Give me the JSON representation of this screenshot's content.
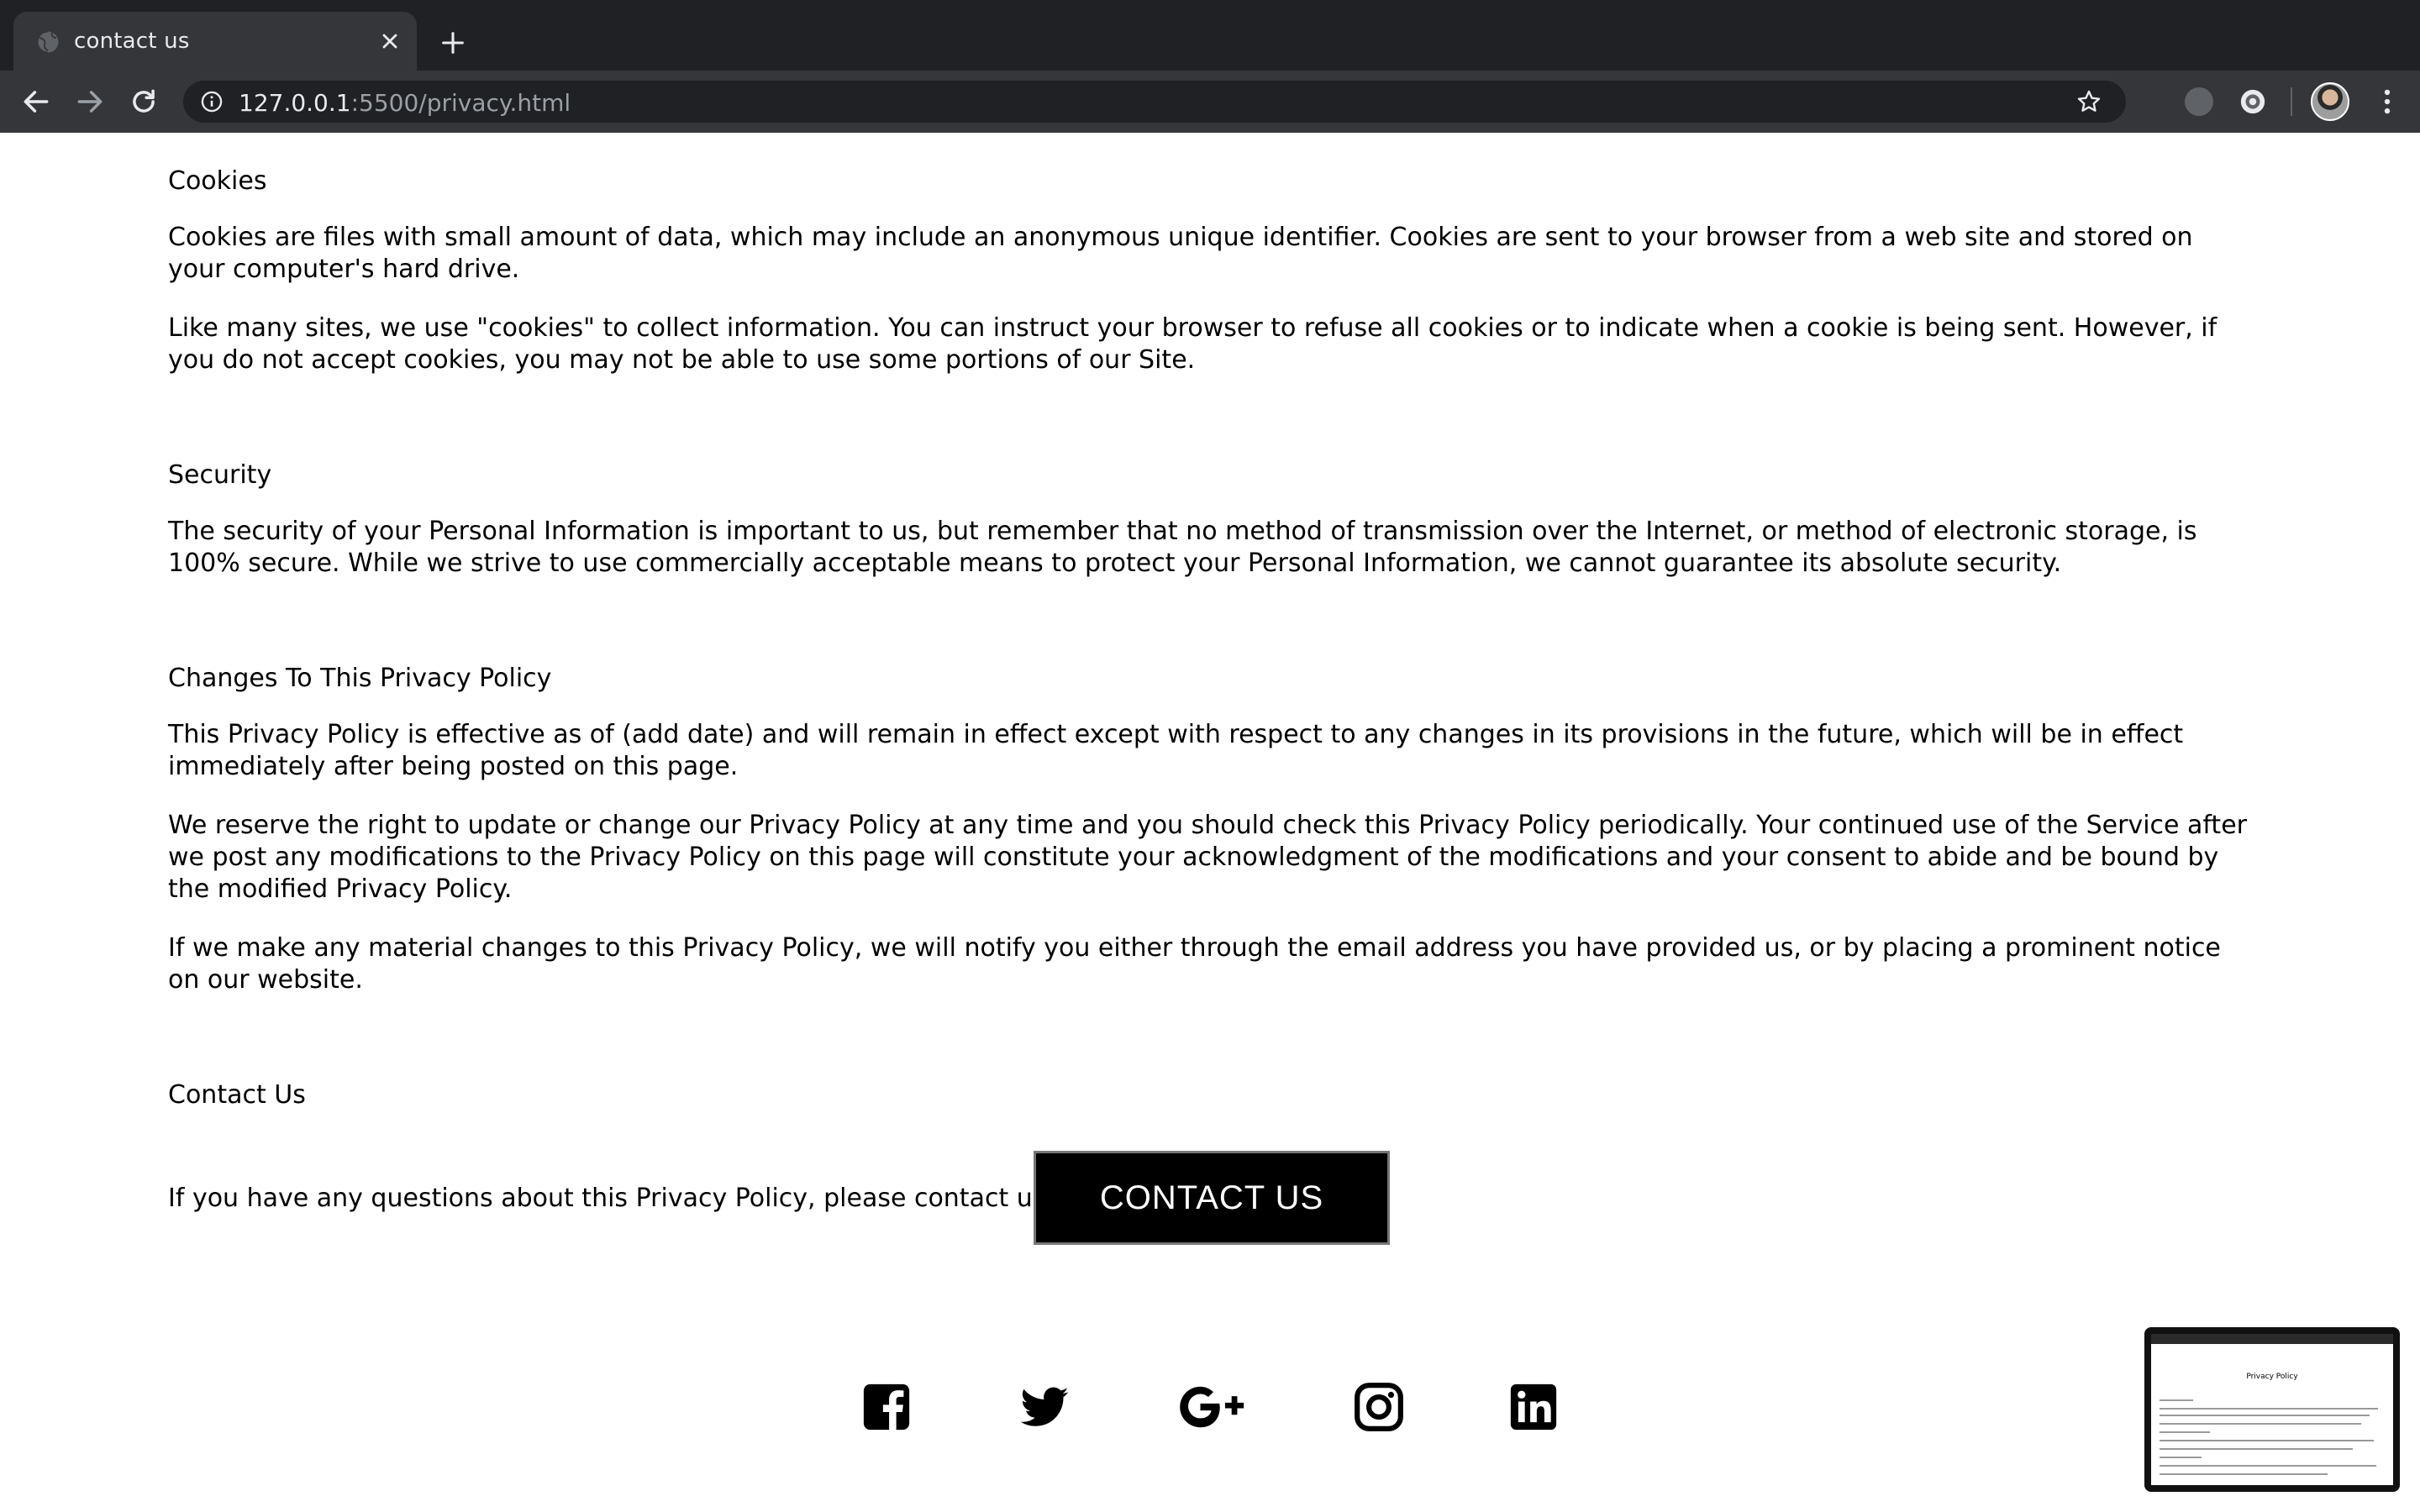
{
  "browser": {
    "tab_title": "contact us",
    "url_host": "127.0.0.1",
    "url_rest": ":5500/privacy.html"
  },
  "sections": {
    "cookies": {
      "heading": "Cookies",
      "p1": "Cookies are files with small amount of data, which may include an anonymous unique identifier. Cookies are sent to your browser from a web site and stored on your computer's hard drive.",
      "p2": "Like many sites, we use \"cookies\" to collect information. You can instruct your browser to refuse all cookies or to indicate when a cookie is being sent. However, if you do not accept cookies, you may not be able to use some portions of our Site."
    },
    "security": {
      "heading": "Security",
      "p1": "The security of your Personal Information is important to us, but remember that no method of transmission over the Internet, or method of electronic storage, is 100% secure. While we strive to use commercially acceptable means to protect your Personal Information, we cannot guarantee its absolute security."
    },
    "changes": {
      "heading": "Changes To This Privacy Policy",
      "p1": "This Privacy Policy is effective as of (add date) and will remain in effect except with respect to any changes in its provisions in the future, which will be in effect immediately after being posted on this page.",
      "p2": "We reserve the right to update or change our Privacy Policy at any time and you should check this Privacy Policy periodically. Your continued use of the Service after we post any modifications to the Privacy Policy on this page will constitute your acknowledgment of the modifications and your consent to abide and be bound by the modified Privacy Policy.",
      "p3": "If we make any material changes to this Privacy Policy, we will notify you either through the email address you have provided us, or by placing a prominent notice on our website."
    },
    "contact": {
      "heading": "Contact Us",
      "text": "If you have any questions about this Privacy Policy, please contact us.",
      "button": "CONTACT US"
    }
  },
  "social_icons": [
    "facebook-icon",
    "twitter-icon",
    "google-plus-icon",
    "instagram-icon",
    "linkedin-icon"
  ],
  "thumbnail": {
    "title": "Privacy Policy"
  }
}
